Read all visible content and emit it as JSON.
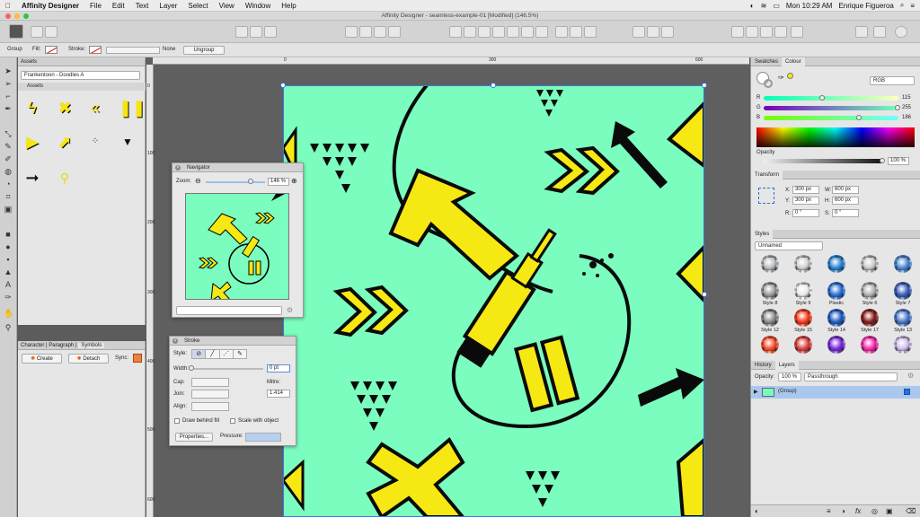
{
  "menubar": {
    "apple": "",
    "items": [
      "Affinity Designer",
      "File",
      "Edit",
      "Text",
      "Layer",
      "Select",
      "View",
      "Window",
      "Help"
    ],
    "clock": "Mon 10:29 AM",
    "user": "Enrique Figueroa"
  },
  "window": {
    "title": "Affinity Designer - seamless-example-01 [Modified] (146.5%)"
  },
  "context_toolbar": {
    "group_label": "Group",
    "fill_label": "Fill:",
    "stroke_label": "Stroke:",
    "stroke_width": "None",
    "ungroup_button": "Ungroup"
  },
  "assets_panel": {
    "tab": "Assets",
    "category": "Frankentoon - Doodles A",
    "subcategory": "Assets"
  },
  "symbols_panel": {
    "tabs": [
      "Character",
      "Paragraph",
      "Symbols"
    ],
    "create_button": "Create",
    "detach_button": "Detach",
    "sync_label": "Sync:"
  },
  "rulers": {
    "top": [
      "0",
      "300",
      "600"
    ],
    "left": [
      "0",
      "100",
      "200",
      "300",
      "400",
      "500",
      "600"
    ]
  },
  "navigator": {
    "title": "Navigator",
    "zoom_label": "Zoom:",
    "zoom_value": "146 %"
  },
  "stroke_panel": {
    "title": "Stroke",
    "style_label": "Style:",
    "width_label": "Width:",
    "width_value": "0 pt",
    "cap_label": "Cap:",
    "join_label": "Join:",
    "mitre_label": "Mitre:",
    "mitre_value": "1.414",
    "align_label": "Align:",
    "behind_fill": "Draw behind fill",
    "scale_object": "Scale with object",
    "properties_button": "Properties...",
    "pressure_label": "Pressure:"
  },
  "colour_panel": {
    "tabs": [
      "Swatches",
      "Colour"
    ],
    "mode": "RGB",
    "r_label": "R",
    "r_value": "115",
    "g_label": "G",
    "g_value": "255",
    "b_label": "B",
    "b_value": "186",
    "opacity_label": "Opacity",
    "opacity_value": "100 %",
    "fill_color": "#73ffba",
    "stroke_color": "#f7e81a"
  },
  "transform_panel": {
    "title": "Transform",
    "x_label": "X:",
    "x_value": "300 px",
    "y_label": "Y:",
    "y_value": "300 px",
    "w_label": "W:",
    "w_value": "600 px",
    "h_label": "H:",
    "h_value": "600 px",
    "r_label": "R:",
    "r_value": "0 °",
    "s_label": "S:",
    "s_value": "0 °"
  },
  "styles_panel": {
    "title": "Styles",
    "category": "Unnamed",
    "styles": [
      {
        "name": "",
        "color": "#b9bcc0"
      },
      {
        "name": "",
        "color": "#d0d0d0"
      },
      {
        "name": "",
        "color": "#2a86d9"
      },
      {
        "name": "",
        "color": "#c9c9c9"
      },
      {
        "name": "",
        "color": "#4a8ad8"
      },
      {
        "name": "Style 8",
        "color": "#9a9a9a"
      },
      {
        "name": "Style 9",
        "color": "#e8e8e8"
      },
      {
        "name": "Plastic",
        "color": "#2a72d8"
      },
      {
        "name": "Style 6",
        "color": "#b0b0b0"
      },
      {
        "name": "Style 7",
        "color": "#3a5ec0"
      },
      {
        "name": "Style 12",
        "color": "#8a8a8a"
      },
      {
        "name": "Style 15",
        "color": "#ff3a1a"
      },
      {
        "name": "Style 14",
        "color": "#1e5fc8"
      },
      {
        "name": "Style 17",
        "color": "#8a1a1a"
      },
      {
        "name": "Style 13",
        "color": "#4a7ad0"
      },
      {
        "name": "",
        "color": "#ff4a2a"
      },
      {
        "name": "",
        "color": "#e04040"
      },
      {
        "name": "",
        "color": "#7a2ae0"
      },
      {
        "name": "",
        "color": "#ff2ab0"
      },
      {
        "name": "",
        "color": "#d0c0f0"
      }
    ]
  },
  "layers_panel": {
    "tabs": [
      "History",
      "Layers"
    ],
    "opacity_label": "Opacity:",
    "opacity_value": "100 %",
    "blend_mode": "Passthrough",
    "layer_name": "(Group)"
  }
}
